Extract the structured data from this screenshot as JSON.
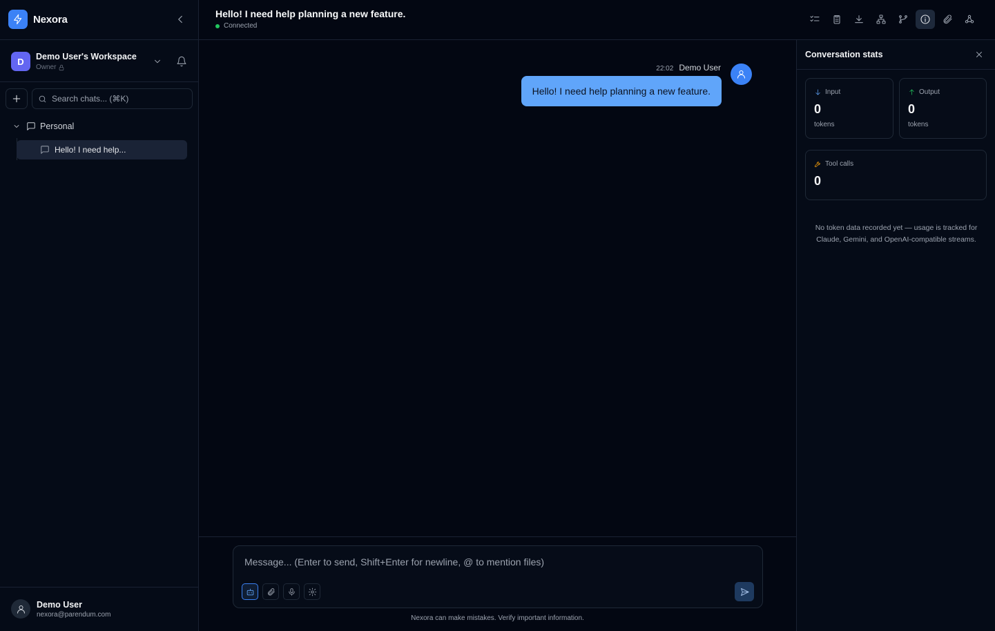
{
  "app": {
    "name": "Nexora"
  },
  "workspace": {
    "avatar_letter": "D",
    "name": "Demo User's Workspace",
    "role": "Owner"
  },
  "search": {
    "placeholder": "Search chats... (⌘K)"
  },
  "sidebar": {
    "folder_label": "Personal",
    "chats": [
      {
        "label": "Hello! I need help..."
      }
    ]
  },
  "user": {
    "name": "Demo User",
    "email": "nexora@parendum.com"
  },
  "header": {
    "title": "Hello! I need help planning a new feature.",
    "status": "Connected",
    "toolbar_icons": [
      "checklist-icon",
      "clipboard-icon",
      "download-icon",
      "sitemap-icon",
      "git-branch-icon",
      "info-icon",
      "paperclip-icon",
      "webhook-icon"
    ],
    "active_tool": "info-icon"
  },
  "messages": [
    {
      "time": "22:02",
      "author": "Demo User",
      "text": "Hello! I need help planning a new feature."
    }
  ],
  "composer": {
    "placeholder": "Message... (Enter to send, Shift+Enter for newline, @ to mention files)",
    "value": "",
    "disclaimer": "Nexora can make mistakes. Verify important information."
  },
  "stats_panel": {
    "title": "Conversation stats",
    "input": {
      "label": "Input",
      "value": "0",
      "unit": "tokens"
    },
    "output": {
      "label": "Output",
      "value": "0",
      "unit": "tokens"
    },
    "tool_calls": {
      "label": "Tool calls",
      "value": "0"
    },
    "note": "No token data recorded yet — usage is tracked for Claude, Gemini, and OpenAI-compatible streams."
  },
  "colors": {
    "accent": "#3b82f6",
    "bubble": "#60a5fa",
    "background": "#030712",
    "status_ok": "#22c55e",
    "workspace_avatar": "#6366f1"
  }
}
